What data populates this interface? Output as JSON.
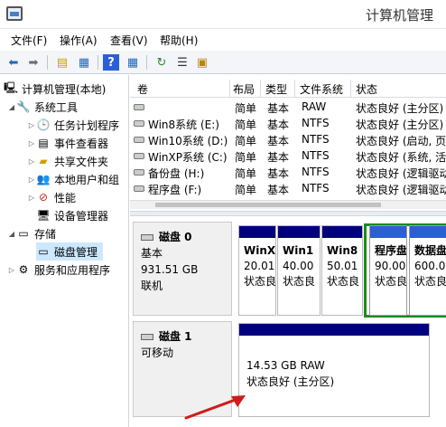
{
  "window": {
    "title": "计算机管理"
  },
  "menu": [
    "文件(F)",
    "操作(A)",
    "查看(V)",
    "帮助(H)"
  ],
  "tree": {
    "root": "计算机管理(本地)",
    "system_tools": "系统工具",
    "task_scheduler": "任务计划程序",
    "event_viewer": "事件查看器",
    "shared_folders": "共享文件夹",
    "local_users": "本地用户和组",
    "performance": "性能",
    "device_manager": "设备管理器",
    "storage": "存储",
    "disk_management": "磁盘管理",
    "services": "服务和应用程序"
  },
  "volume_table": {
    "headers": [
      "卷",
      "布局",
      "类型",
      "文件系统",
      "状态"
    ],
    "rows": [
      {
        "name": "",
        "layout": "简单",
        "type": "基本",
        "fs": "RAW",
        "status": "状态良好 (主分区)"
      },
      {
        "name": "Win8系统 (E:)",
        "layout": "简单",
        "type": "基本",
        "fs": "NTFS",
        "status": "状态良好 (主分区)"
      },
      {
        "name": "Win10系统 (D:)",
        "layout": "简单",
        "type": "基本",
        "fs": "NTFS",
        "status": "状态良好 (启动, 页面"
      },
      {
        "name": "WinXP系统 (C:)",
        "layout": "简单",
        "type": "基本",
        "fs": "NTFS",
        "status": "状态良好 (系统, 活动"
      },
      {
        "name": "备份盘 (H:)",
        "layout": "简单",
        "type": "基本",
        "fs": "NTFS",
        "status": "状态良好 (逻辑驱动"
      },
      {
        "name": "程序盘 (F:)",
        "layout": "简单",
        "type": "基本",
        "fs": "NTFS",
        "status": "状态良好 (逻辑驱动"
      }
    ]
  },
  "disk0": {
    "name": "磁盘 0",
    "kind": "基本",
    "size": "931.51 GB",
    "state": "联机",
    "partitions": [
      {
        "name": "WinX",
        "size": "20.01",
        "status": "状态良"
      },
      {
        "name": "Win1",
        "size": "40.00",
        "status": "状态良"
      },
      {
        "name": "Win8",
        "size": "50.01",
        "status": "状态良"
      },
      {
        "name": "程序盘",
        "size": "90.00",
        "status": "状态良"
      },
      {
        "name": "数据盘",
        "size": "600.0",
        "status": "状态良"
      }
    ]
  },
  "disk1": {
    "name": "磁盘 1",
    "kind": "可移动",
    "partition": {
      "size_fs": "14.53 GB RAW",
      "status": "状态良好 (主分区)"
    }
  },
  "colors": {
    "primary_partition_bar": "#00007f",
    "logical_partition_bar": "#2a5fd8",
    "selection": "#1e8a1e",
    "annotation_arrow": "#d11a1a"
  }
}
